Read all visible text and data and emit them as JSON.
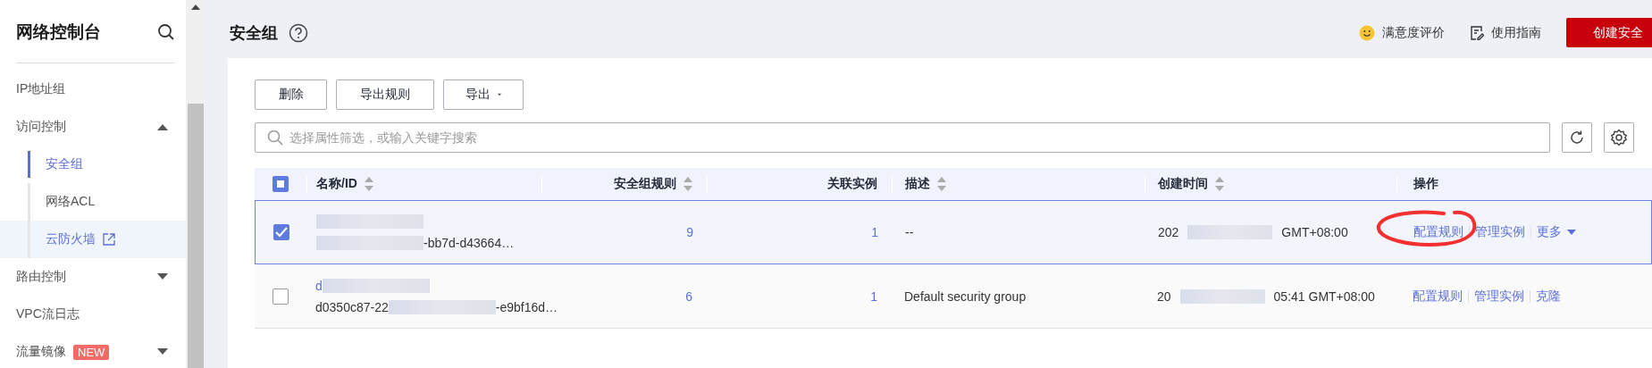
{
  "sidebar": {
    "title": "网络控制台",
    "items": [
      {
        "label": "IP地址组",
        "selected": false
      },
      {
        "label": "访问控制",
        "selected": false,
        "expanded": true,
        "children": [
          {
            "label": "安全组",
            "selected": true,
            "highlighted": false
          },
          {
            "label": "网络ACL",
            "selected": false,
            "highlighted": false
          },
          {
            "label": "云防火墙",
            "selected": false,
            "highlighted": true,
            "external": true
          }
        ]
      },
      {
        "label": "路由控制",
        "selected": false,
        "expanded": false
      },
      {
        "label": "VPC流日志",
        "selected": false
      },
      {
        "label": "流量镜像",
        "selected": false,
        "expanded": false,
        "badge": "NEW"
      }
    ]
  },
  "header": {
    "title": "安全组",
    "links": [
      {
        "kind": "smiley",
        "label": "满意度评价"
      },
      {
        "kind": "guide",
        "label": "使用指南"
      }
    ],
    "primary_button": "创建安全"
  },
  "toolbar": {
    "buttons": [
      {
        "label": "删除",
        "dropdown": false
      },
      {
        "label": "导出规则",
        "dropdown": false
      },
      {
        "label": "导出",
        "dropdown": true
      }
    ],
    "search": {
      "placeholder": "选择属性筛选，或输入关键字搜索"
    }
  },
  "table": {
    "indeterminate": true,
    "columns": [
      {
        "label": "名称/ID",
        "sortable": true
      },
      {
        "label": "安全组规则",
        "sortable": true
      },
      {
        "label": "关联实例"
      },
      {
        "label": "描述",
        "sortable": true
      },
      {
        "label": "创建时间",
        "sortable": true
      },
      {
        "label": "操作"
      }
    ],
    "rows": [
      {
        "selected": true,
        "id_end": "-bb7d-d43664…",
        "rules": "9",
        "instances": "1",
        "description": "--",
        "time_start": "202",
        "time_end": "GMT+08:00",
        "actions": [
          {
            "label": "配置规则",
            "circled": true
          },
          {
            "label": "管理实例",
            "circled": false
          },
          {
            "label": "更多",
            "dropdown": true,
            "circled": false
          }
        ]
      },
      {
        "selected": false,
        "name": "d",
        "id_start": "d0350c87-22",
        "id_end": "-e9bf16d…",
        "rules": "6",
        "instances": "1",
        "description": "Default security group",
        "time_start": "20",
        "time_end": "05:41 GMT+08:00",
        "actions": [
          {
            "label": "配置规则",
            "circled": false
          },
          {
            "label": "管理实例",
            "circled": false
          },
          {
            "label": "克隆",
            "circled": false
          }
        ]
      }
    ]
  }
}
